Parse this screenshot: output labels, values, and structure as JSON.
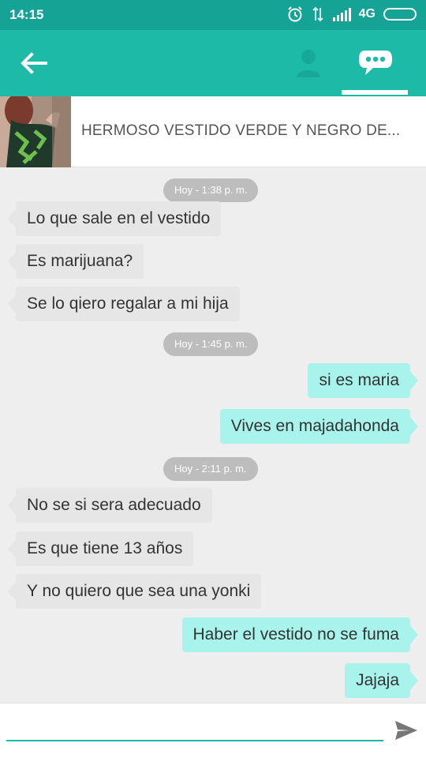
{
  "status_bar": {
    "time": "14:15",
    "network": "4G",
    "icons": [
      "alarm-icon",
      "data-transfer-icon",
      "signal-icon",
      "battery-icon"
    ]
  },
  "app_bar": {
    "color": "#1dbaa8",
    "icons": [
      "back-arrow-icon",
      "person-icon",
      "chat-bubble-icon"
    ],
    "active_tab": "chat"
  },
  "product": {
    "title": "HERMOSO VESTIDO VERDE Y NEGRO DE..."
  },
  "chat": {
    "incoming_color": "#e6e6e6",
    "outgoing_color": "#a8f3ec",
    "timestamps": [
      "Hoy - 1:38 p. m.",
      "Hoy - 1:45 p. m.",
      "Hoy - 2:11 p. m."
    ],
    "messages": [
      {
        "direction": "incoming",
        "text": "Lo que sale en el vestido"
      },
      {
        "direction": "incoming",
        "text": "Es marijuana?"
      },
      {
        "direction": "incoming",
        "text": "Se lo qiero regalar a mi hija"
      },
      {
        "direction": "outgoing",
        "text": "si es maria"
      },
      {
        "direction": "outgoing",
        "text": "Vives en majadahonda"
      },
      {
        "direction": "incoming",
        "text": "No se si sera adecuado"
      },
      {
        "direction": "incoming",
        "text": "Es que tiene 13 años"
      },
      {
        "direction": "incoming",
        "text": "Y no quiero que sea una yonki"
      },
      {
        "direction": "outgoing",
        "text": "Haber el vestido no se fuma"
      },
      {
        "direction": "outgoing",
        "text": "Jajaja"
      }
    ]
  },
  "composer": {
    "value": "",
    "placeholder": "",
    "send_icon": "send-icon"
  }
}
